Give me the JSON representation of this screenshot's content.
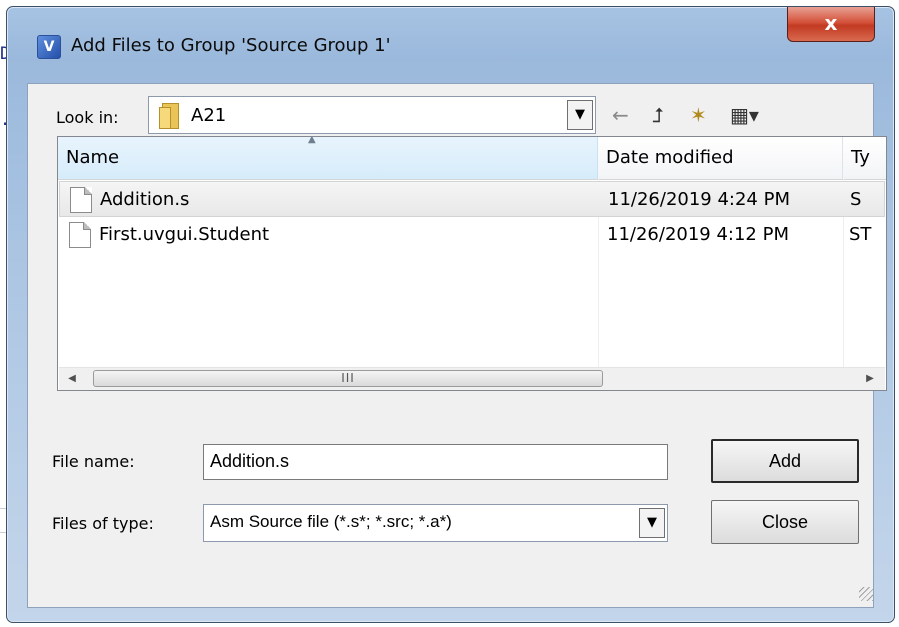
{
  "background": {
    "fragment_top": "DI",
    "fragment_mid": ".e"
  },
  "window": {
    "title": "Add Files to Group 'Source Group 1'",
    "app_icon_glyph": "V",
    "close_glyph": "x",
    "titlebar_color": "#a7c3e3",
    "close_color": "#c23a22"
  },
  "look_in": {
    "label": "Look in:",
    "value": "A21",
    "arrow": "▼"
  },
  "toolbar": {
    "back_glyph": "←",
    "up_glyph": "⮥",
    "new_folder_glyph": "✶",
    "views_glyph": "▦▾"
  },
  "file_list": {
    "columns": [
      "Name",
      "Date modified",
      "Ty"
    ],
    "sort_arrow": "▲",
    "rows": [
      {
        "name": "Addition.s",
        "date": "11/26/2019 4:24 PM",
        "type": "S"
      },
      {
        "name": "First.uvgui.Student",
        "date": "11/26/2019 4:12 PM",
        "type": "ST"
      }
    ],
    "selected_index": 0
  },
  "scrollbar": {
    "left_glyph": "◀",
    "right_glyph": "▶",
    "thumb_grip": "III"
  },
  "file_name": {
    "label": "File name:",
    "value": "Addition.s"
  },
  "file_type": {
    "label": "Files of type:",
    "value": "Asm Source file (*.s*; *.src; *.a*)",
    "arrow": "▼"
  },
  "buttons": {
    "add": "Add",
    "close": "Close"
  }
}
